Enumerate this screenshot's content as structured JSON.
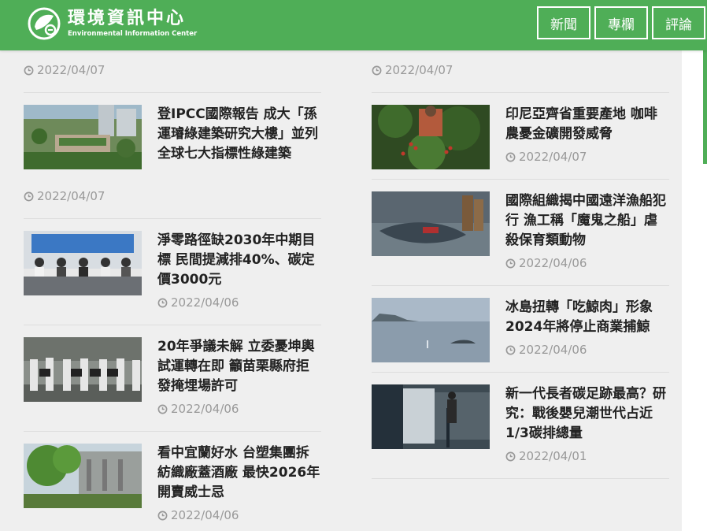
{
  "site": {
    "name_zh": "環境資訊中心",
    "name_en": "Environmental Information Center"
  },
  "nav": [
    {
      "label": "新聞"
    },
    {
      "label": "專欄"
    },
    {
      "label": "評論"
    }
  ],
  "colors": {
    "brand": "#4fae57",
    "date": "#999999"
  },
  "left": {
    "top_date": "2022/04/07",
    "items": [
      {
        "title": "登IPCC國際報告 成大「孫運璿綠建築研究大樓」並列全球七大指標性綠建築",
        "date": "2022/04/07",
        "thumb": "green-building-aerial"
      },
      {
        "title": "淨零路徑缺2030年中期目標 民間提減排40%、碳定價3000元",
        "date": "2022/04/06",
        "thumb": "press-conference"
      },
      {
        "title": "20年爭議未解 立委憂坤輿試運轉在即 籲苗栗縣府拒發掩埋場許可",
        "date": "2022/04/06",
        "thumb": "protest-signs"
      },
      {
        "title": "看中宜蘭好水 台塑集團拆紡織廠蓋酒廠 最快2026年開賣威士忌",
        "date": "2022/04/06",
        "thumb": "factory-trees"
      }
    ]
  },
  "right": {
    "top_date": "2022/04/07",
    "items": [
      {
        "title": "印尼亞齊省重要產地 咖啡農憂金礦開發威脅",
        "date": "2022/04/07",
        "thumb": "coffee-farmer"
      },
      {
        "title": "國際組織揭中國遠洋漁船犯行 漁工稱「魔鬼之船」虐殺保育類動物",
        "date": "2022/04/06",
        "thumb": "fishing-deck"
      },
      {
        "title": "冰島扭轉「吃鯨肉」形象 2024年將停止商業捕鯨",
        "date": "2022/04/06",
        "thumb": "whale-sea"
      },
      {
        "title": "新一代長者碳足跡最高？研究：戰後嬰兒潮世代占近1/3碳排總量",
        "date": "2022/04/01",
        "thumb": "elderly-reading"
      }
    ]
  }
}
